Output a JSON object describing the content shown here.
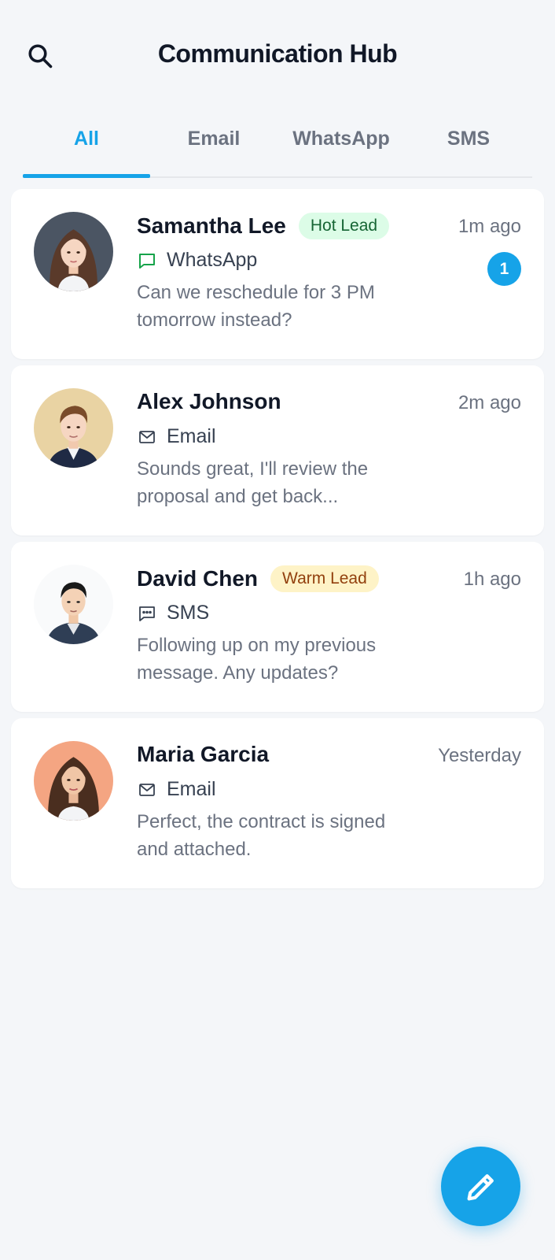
{
  "header": {
    "title": "Communication Hub",
    "search_icon": "search-icon"
  },
  "tabs": [
    {
      "label": "All",
      "active": true
    },
    {
      "label": "Email",
      "active": false
    },
    {
      "label": "WhatsApp",
      "active": false
    },
    {
      "label": "SMS",
      "active": false
    }
  ],
  "conversations": [
    {
      "name": "Samantha Lee",
      "badge": "Hot Lead",
      "channel": "WhatsApp",
      "channel_icon": "whatsapp-chat-icon",
      "time": "1m ago",
      "unread": "1",
      "preview": "Can we reschedule for 3 PM tomorrow instead?"
    },
    {
      "name": "Alex Johnson",
      "channel": "Email",
      "channel_icon": "mail-icon",
      "time": "2m ago",
      "preview": "Sounds great, I'll review the proposal and get back..."
    },
    {
      "name": "David Chen",
      "badge": "Warm Lead",
      "channel": "SMS",
      "channel_icon": "sms-icon",
      "time": "1h ago",
      "preview": "Following up on my previous message. Any updates?"
    },
    {
      "name": "Maria Garcia",
      "channel": "Email",
      "channel_icon": "mail-icon",
      "time": "Yesterday",
      "preview": "Perfect, the contract is signed and attached."
    }
  ],
  "fab": {
    "icon": "pencil-icon"
  },
  "colors": {
    "accent": "#16a3e8",
    "hot_lead_bg": "#dcfce7",
    "warm_lead_bg": "#fef3c7",
    "whatsapp_green": "#16a34a"
  }
}
